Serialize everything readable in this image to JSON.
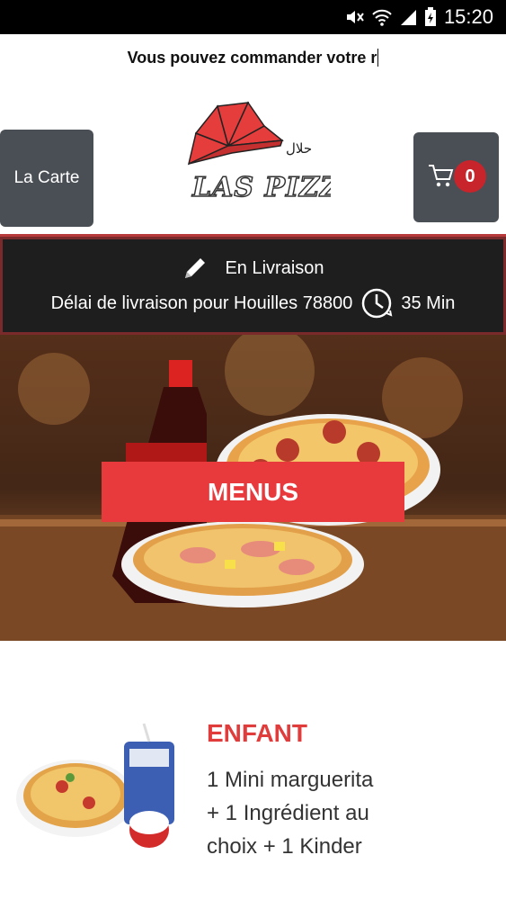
{
  "status_bar": {
    "time": "15:20"
  },
  "ticker": {
    "text": "Vous pouvez commander votre r"
  },
  "header": {
    "menu_button": "La Carte",
    "logo": {
      "name": "LAS PIZZA",
      "halal": "حلال"
    },
    "cart": {
      "count": "0"
    }
  },
  "delivery": {
    "mode": "En Livraison",
    "delay_text": "Délai de livraison pour Houilles 78800",
    "delay_value": "35 Min"
  },
  "banner": {
    "button_label": "MENUS"
  },
  "menu_item": {
    "title": "ENFANT",
    "description": "1 Mini marguerita + 1 Ingrédient au choix + 1 Kinder"
  },
  "colors": {
    "accent": "#e83a3c",
    "button_dark": "#4a4f55",
    "badge": "#c8242b",
    "bar_dark": "#1e1e1e"
  }
}
